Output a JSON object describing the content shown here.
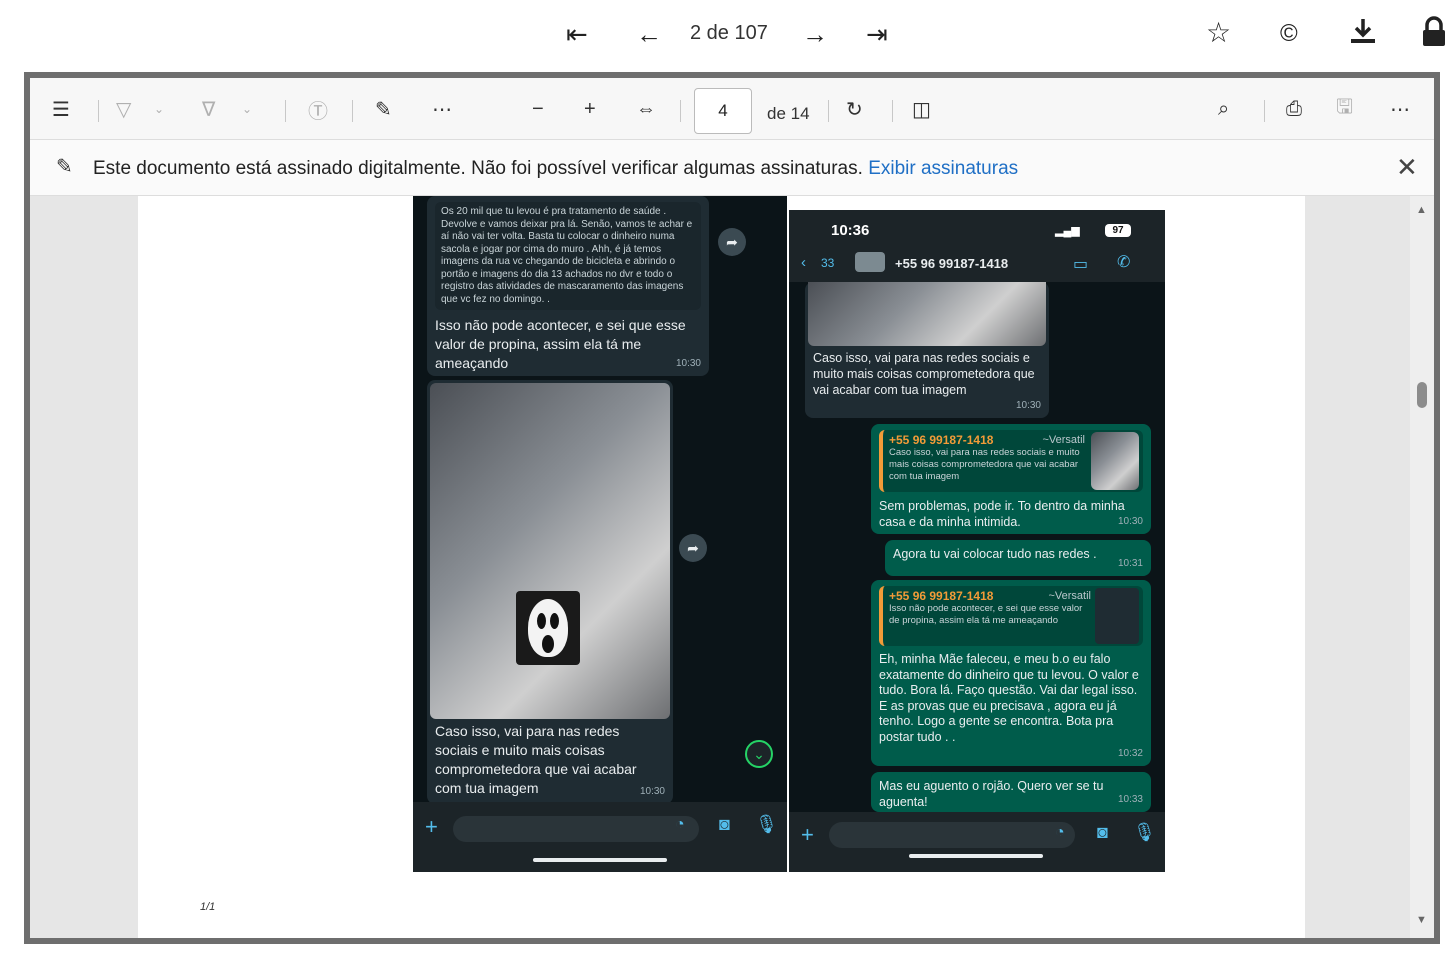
{
  "viewer": {
    "pager": "2 de 107"
  },
  "toolbar": {
    "page_value": "4",
    "page_total": "de 14"
  },
  "signature_bar": {
    "message": "Este documento está assinado digitalmente. Não foi possível verificar algumas assinaturas.",
    "link": "Exibir assinaturas"
  },
  "page_footer": "1/1",
  "left_phone": {
    "top_quote": "Os 20 mil que tu levou é pra tratamento de saúde . Devolve e vamos deixar pra lá. Senão, vamos te achar e aí não vai ter volta. Basta tu colocar o dinheiro numa sacola e jogar por cima do muro . Ahh, é já temos imagens da rua vc chegando de bicicleta e abrindo o portão e imagens do dia 13 achados no dvr e todo o registro das atividades de mascaramento das imagens que vc fez no domingo. .",
    "msg1": {
      "text": "Isso não pode acontecer, e sei que esse valor de propina, assim ela tá me ameaçando",
      "time": "10:30"
    },
    "msg2": {
      "text": "Caso isso, vai para nas redes sociais e muito mais coisas comprometedora que vai acabar com tua imagem",
      "time": "10:30"
    }
  },
  "right_phone": {
    "status_time": "10:36",
    "battery": "97",
    "back_count": "33",
    "contact": "+55 96 99187-1418",
    "msg1": {
      "text": "Caso isso, vai para nas redes sociais e muito mais coisas comprometedora que vai acabar com tua imagem",
      "time": "10:30"
    },
    "reply1": {
      "quote_name": "+55 96 99187-1418",
      "quote_tag": "~Versatil",
      "quote_text": "Caso isso, vai para nas redes sociais e muito mais coisas comprometedora que vai acabar com tua imagem",
      "text": "Sem problemas, pode ir. To dentro da minha casa e da minha intimida.",
      "time": "10:30"
    },
    "reply2": {
      "text": "Agora tu vai colocar tudo nas redes .",
      "time": "10:31"
    },
    "reply3": {
      "quote_name": "+55 96 99187-1418",
      "quote_tag": "~Versatil",
      "quote_text": "Isso não pode acontecer, e sei que esse valor de propina, assim ela tá me ameaçando",
      "text": "Eh, minha Mãe faleceu, e meu b.o eu falo exatamente do dinheiro que tu levou. O valor e tudo. Bora lá. Faço questão. Vai dar legal isso. E as provas que eu precisava , agora eu já tenho. Logo a gente se encontra. Bota pra postar tudo . .",
      "time": "10:32"
    },
    "reply4": {
      "text": "Mas eu aguento o rojão. Quero ver se tu aguenta!",
      "time": "10:33"
    }
  }
}
